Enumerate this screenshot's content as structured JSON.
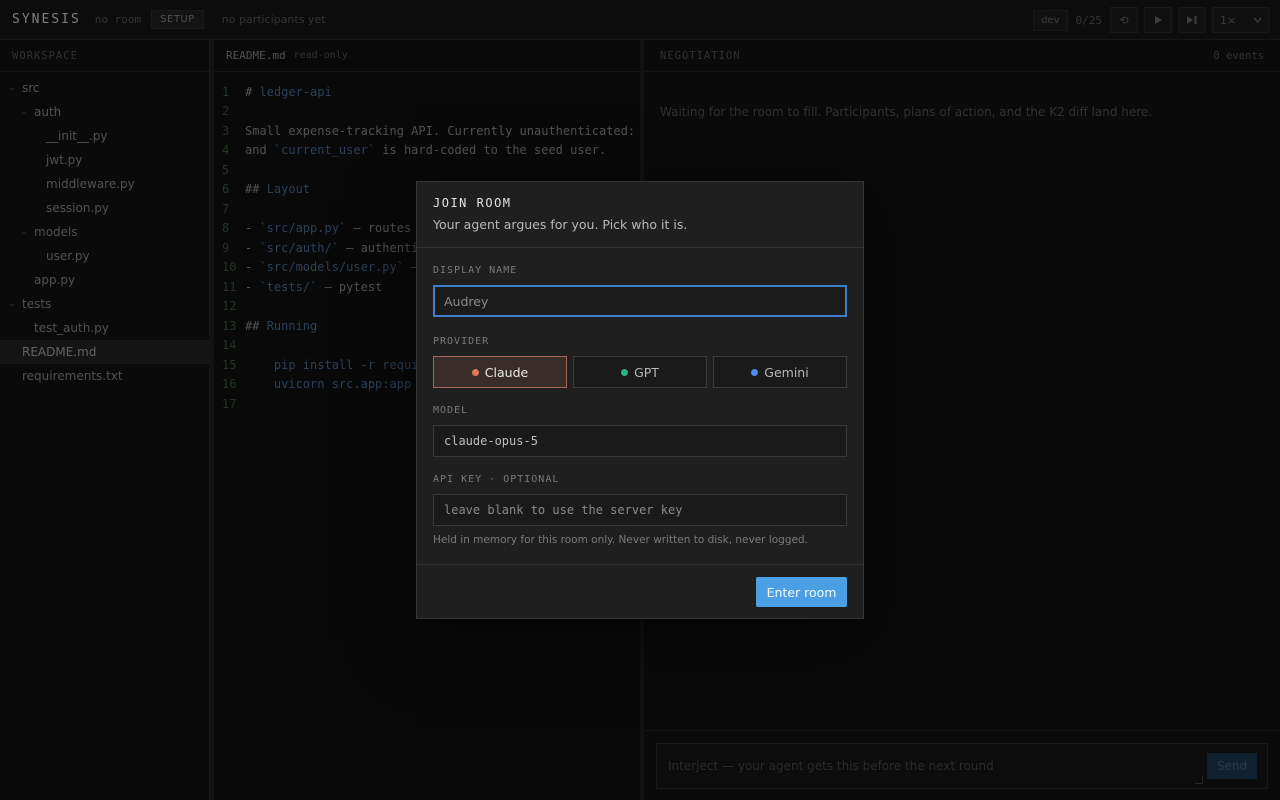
{
  "topbar": {
    "brand": "SYNESIS",
    "room_status": "no room",
    "phase": "SETUP",
    "participants": "no participants yet",
    "dev_label": "dev",
    "counter": "0/25",
    "reset_icon": "reset-icon",
    "play_icon": "play-icon",
    "step_icon": "step-forward-icon",
    "speed": "1×"
  },
  "workspace": {
    "title": "WORKSPACE",
    "tree": [
      {
        "label": "src",
        "type": "folder",
        "depth": 0
      },
      {
        "label": "auth",
        "type": "folder",
        "depth": 1
      },
      {
        "label": "__init__.py",
        "type": "file",
        "depth": 2
      },
      {
        "label": "jwt.py",
        "type": "file",
        "depth": 2
      },
      {
        "label": "middleware.py",
        "type": "file",
        "depth": 2
      },
      {
        "label": "session.py",
        "type": "file",
        "depth": 2
      },
      {
        "label": "models",
        "type": "folder",
        "depth": 1
      },
      {
        "label": "user.py",
        "type": "file",
        "depth": 2
      },
      {
        "label": "app.py",
        "type": "file",
        "depth": 1
      },
      {
        "label": "tests",
        "type": "folder",
        "depth": 0
      },
      {
        "label": "test_auth.py",
        "type": "file",
        "depth": 1
      },
      {
        "label": "README.md",
        "type": "file",
        "depth": 0,
        "active": true
      },
      {
        "label": "requirements.txt",
        "type": "file",
        "depth": 0
      }
    ]
  },
  "editor": {
    "filename": "README.md",
    "mode": "read-only",
    "lines": [
      "# ledger-api",
      "",
      "Small expense-tracking API. Currently unauthenticated: ev",
      "and `current_user` is hard-coded to the seed user.",
      "",
      "## Layout",
      "",
      "- `src/app.py` — routes",
      "- `src/auth/` — authentic",
      "- `src/models/user.py` — ",
      "- `tests/` — pytest",
      "",
      "## Running",
      "",
      "    pip install -r requir",
      "    uvicorn src.app:app -",
      ""
    ]
  },
  "negotiation": {
    "title": "NEGOTIATION",
    "events": "0 events",
    "empty_message": "Waiting for the room to fill. Participants, plans of action, and the K2 diff land here.",
    "interject_placeholder": "Interject — your agent gets this before the next round",
    "send_label": "Send"
  },
  "modal": {
    "title": "JOIN ROOM",
    "subtitle": "Your agent argues for you. Pick who it is.",
    "display_name_label": "DISPLAY NAME",
    "display_name_placeholder": "Audrey",
    "provider_label": "PROVIDER",
    "providers": [
      {
        "label": "Claude",
        "color": "#e07a5a",
        "selected": true
      },
      {
        "label": "GPT",
        "color": "#2bb08a",
        "selected": false
      },
      {
        "label": "Gemini",
        "color": "#4d8ef0",
        "selected": false
      }
    ],
    "model_label": "MODEL",
    "model_value": "claude-opus-5",
    "api_key_label": "API KEY · OPTIONAL",
    "api_key_placeholder": "leave blank to use the server key",
    "api_key_help": "Held in memory for this room only. Never written to disk, never logged.",
    "enter_label": "Enter room"
  },
  "colors": {
    "accent": "#4a9fe5",
    "claude": "#e07a5a",
    "gpt": "#2bb08a",
    "gemini": "#4d8ef0"
  }
}
